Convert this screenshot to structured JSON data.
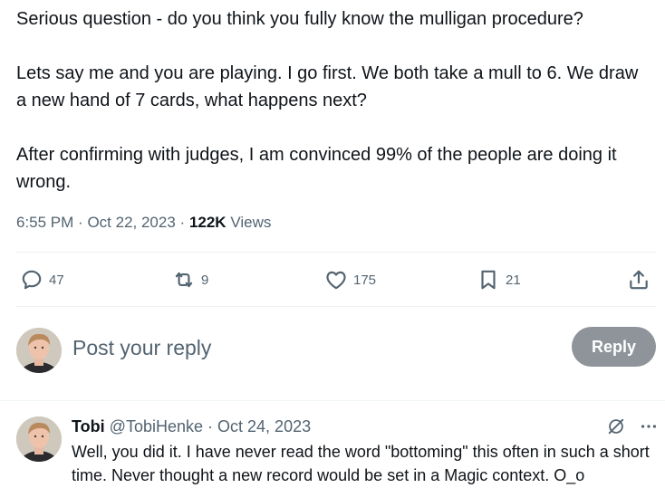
{
  "tweet": {
    "lines": [
      "Serious question - do you think you fully know the mulligan procedure?",
      "Lets say me and you are playing. I go first. We both take a mull to 6. We draw a new hand of 7 cards, what happens next?",
      "After confirming with judges, I am convinced 99% of the people are doing it wrong."
    ],
    "time": "6:55 PM",
    "date": "Oct 22, 2023",
    "separator": "·",
    "views_count": "122K",
    "views_label": "Views"
  },
  "actions": {
    "replies": "47",
    "reposts": "9",
    "likes": "175",
    "bookmarks": "21"
  },
  "icons": {
    "reply": "comment-bubble-icon",
    "repost": "repost-icon",
    "like": "heart-icon",
    "bookmark": "bookmark-icon",
    "share": "share-icon",
    "grok": "grok-icon",
    "more": "more-dots-icon"
  },
  "compose": {
    "placeholder": "Post your reply",
    "button": "Reply"
  },
  "reply": {
    "name": "Tobi",
    "handle": "@TobiHenke",
    "separator": "·",
    "date": "Oct 24, 2023",
    "text": "Well, you did it. I have never read the word \"bottoming\" this often in such a short time. Never thought a new record would be set in a Magic context. O_o"
  },
  "colors": {
    "text_primary": "#0f1419",
    "text_secondary": "#536471",
    "divider": "#eff3f4",
    "reply_button_disabled": "#8e9499"
  }
}
